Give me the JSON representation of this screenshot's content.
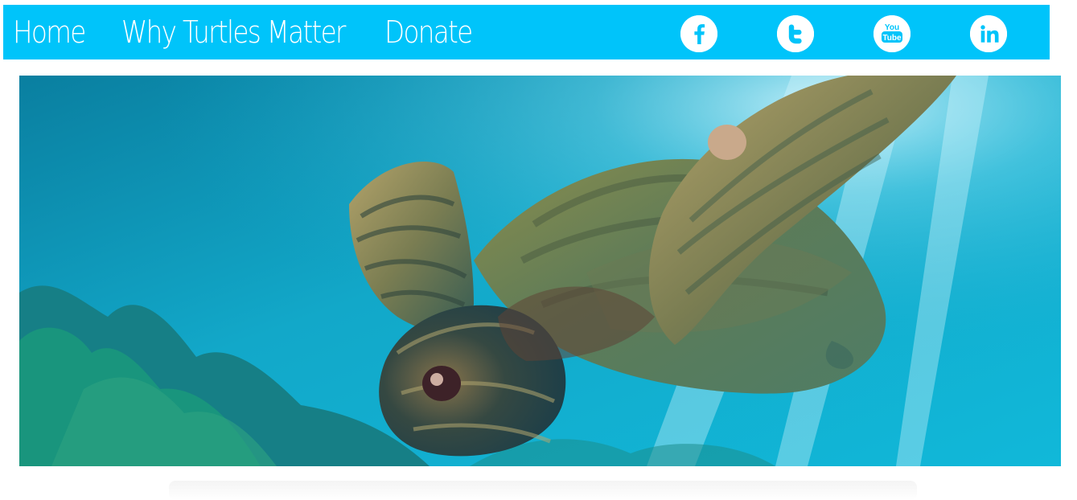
{
  "nav": {
    "links": [
      {
        "label": "Home"
      },
      {
        "label": "Why Turtles Matter"
      },
      {
        "label": "Donate"
      }
    ],
    "social": [
      {
        "icon": "facebook-icon",
        "glyph": "f"
      },
      {
        "icon": "twitter-icon",
        "glyph": "t"
      },
      {
        "icon": "youtube-icon",
        "glyph_top": "You",
        "glyph_bottom": "Tube"
      },
      {
        "icon": "linkedin-icon",
        "glyph": "in"
      }
    ],
    "colors": {
      "nav_background": "#00c4fa",
      "text": "#ffffff"
    }
  },
  "hero": {
    "image": "sea-turtle-underwater"
  }
}
